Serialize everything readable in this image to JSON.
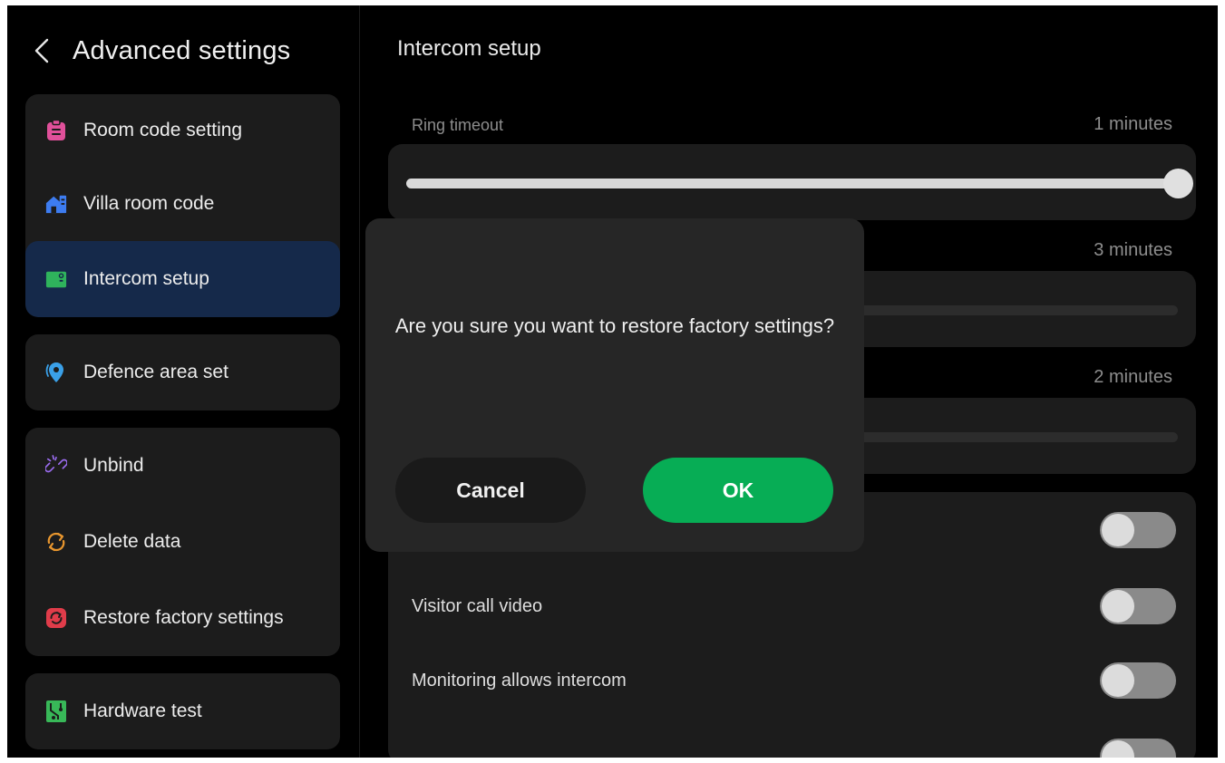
{
  "header": {
    "title": "Advanced settings"
  },
  "sidebar": {
    "groups": [
      {
        "items": [
          {
            "label": "Room code setting",
            "icon": "clipboard-icon",
            "color": "#e0509a"
          },
          {
            "label": "Villa room code",
            "icon": "house-icon",
            "color": "#3d7cf0"
          },
          {
            "label": "Intercom setup",
            "icon": "intercom-icon",
            "color": "#2fb35c",
            "active": true
          }
        ]
      },
      {
        "items": [
          {
            "label": "Defence area set",
            "icon": "location-pin-icon",
            "color": "#3aa0e8"
          }
        ]
      },
      {
        "items": [
          {
            "label": "Unbind",
            "icon": "unlink-icon",
            "color": "#9b6cf0"
          },
          {
            "label": "Delete data",
            "icon": "refresh-icon",
            "color": "#e8962e"
          },
          {
            "label": "Restore factory settings",
            "icon": "restore-icon",
            "color": "#e03c4a"
          }
        ]
      },
      {
        "items": [
          {
            "label": "Hardware test",
            "icon": "circuit-icon",
            "color": "#38b858"
          }
        ]
      }
    ]
  },
  "main": {
    "title": "Intercom setup",
    "ring_timeout": {
      "label": "Ring timeout",
      "value": "1 minutes",
      "level": 1.0
    },
    "slider2": {
      "value": "3 minutes"
    },
    "slider3": {
      "value": "2 minutes"
    },
    "toggles": [
      {
        "label": "",
        "on": false
      },
      {
        "label": "Visitor call video",
        "on": false
      },
      {
        "label": "Monitoring allows intercom",
        "on": false
      }
    ]
  },
  "dialog": {
    "message": "Are you sure you want to restore factory settings?",
    "cancel_label": "Cancel",
    "ok_label": "OK"
  },
  "colors": {
    "accent_green": "#07ad55",
    "active_item_bg": "#15294a",
    "card_bg": "#1c1c1c"
  }
}
